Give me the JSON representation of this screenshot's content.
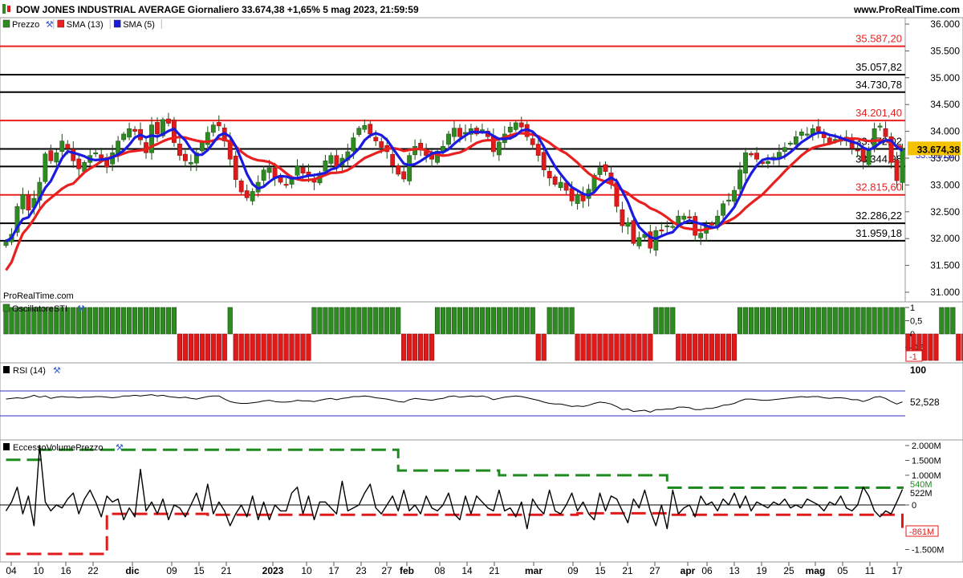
{
  "header": {
    "title": "DOW JONES INDUSTRIAL AVERAGE Giornaliero 33.674,38 +1,65% 5 mag 2023, 21:59:59",
    "brand": "www.ProRealTime.com",
    "watermark": "ProRealTime.com"
  },
  "colors": {
    "up": "#2e8b22",
    "down": "#e01a1a",
    "sma13": "#e82020",
    "sma5": "#1a1ae0",
    "price_tag": "#f5c200"
  },
  "chart_data": [
    {
      "type": "candlestick",
      "legend": [
        {
          "label": "Prezzo",
          "color": "#2e8b22"
        },
        {
          "label": "SMA (13)",
          "color": "#e82020"
        },
        {
          "label": "SMA (5)",
          "color": "#1a1ae0"
        }
      ],
      "ylim": [
        31000,
        36000
      ],
      "y_ticks": [
        "36.000",
        "35.500",
        "35.000",
        "34.500",
        "34.000",
        "33.500",
        "33.000",
        "32.500",
        "32.000",
        "31.500",
        "31.000"
      ],
      "x_ticks": [
        "04",
        "10",
        "16",
        "22",
        "dic",
        "09",
        "15",
        "21",
        "2023",
        "10",
        "17",
        "23",
        "27",
        "feb",
        "08",
        "14",
        "21",
        "mar",
        "09",
        "15",
        "21",
        "27",
        "apr",
        "06",
        "13",
        "19",
        "25",
        "mag",
        "05",
        "11",
        "17"
      ],
      "levels": [
        {
          "value": 35587.2,
          "label": "35.587,20",
          "color": "#e82020"
        },
        {
          "value": 35057.82,
          "label": "35.057,82",
          "color": "#000000"
        },
        {
          "value": 34730.78,
          "label": "34.730,78",
          "color": "#000000"
        },
        {
          "value": 34201.4,
          "label": "34.201,40",
          "color": "#e82020"
        },
        {
          "value": 33672.02,
          "label": "33.672,02",
          "color": "#000000"
        },
        {
          "value": 33344.98,
          "label": "33.344,98",
          "color": "#000000"
        },
        {
          "value": 32815.6,
          "label": "32.815,60",
          "color": "#e82020"
        },
        {
          "value": 32286.22,
          "label": "32.286,22",
          "color": "#000000"
        },
        {
          "value": 31959.18,
          "label": "31.959,18",
          "color": "#000000"
        }
      ],
      "last_price": "33.674,38",
      "sma13_last": "33.608,38",
      "sma5_last": "33.590,32",
      "closes": [
        31950,
        32080,
        32600,
        32820,
        32530,
        32750,
        33050,
        33580,
        33450,
        33600,
        33820,
        33680,
        33450,
        33300,
        33420,
        33550,
        33600,
        33500,
        33330,
        33600,
        33820,
        33950,
        34050,
        34000,
        33840,
        33600,
        34120,
        33950,
        34220,
        34150,
        33790,
        33550,
        33450,
        33420,
        33600,
        33800,
        33980,
        34120,
        34100,
        33820,
        33480,
        33100,
        32870,
        32760,
        32880,
        33050,
        33280,
        33320,
        33130,
        33050,
        33000,
        33120,
        33350,
        33220,
        33180,
        33050,
        33220,
        33450,
        33550,
        33320,
        33500,
        33620,
        33880,
        34060,
        34110,
        33950,
        33820,
        33700,
        33620,
        33360,
        33200,
        33110,
        33550,
        33720,
        33650,
        33550,
        33480,
        33630,
        33720,
        33950,
        34060,
        33900,
        33980,
        34050,
        33950,
        34030,
        33900,
        33620,
        33800,
        33950,
        34080,
        34160,
        34080,
        33900,
        33750,
        33550,
        33280,
        33130,
        33010,
        33050,
        32900,
        32700,
        32820,
        32700,
        32920,
        33180,
        33320,
        33250,
        33020,
        32600,
        32240,
        32300,
        31910,
        32020,
        32080,
        31820,
        32150,
        32160,
        32240,
        32230,
        32420,
        32420,
        32380,
        32060,
        32100,
        32240,
        32250,
        32420,
        32650,
        32720,
        32900,
        33280,
        33600,
        33560,
        33480,
        33400,
        33440,
        33520,
        33610,
        33700,
        33780,
        33900,
        33990,
        33950,
        34050,
        34000,
        33880,
        33780,
        33850,
        33880,
        33820,
        33680,
        33650,
        33440,
        33680,
        34050,
        34100,
        33900,
        33420,
        33080,
        33674
      ]
    },
    {
      "type": "bar",
      "legend": [
        {
          "label": "OscillatoreSTI",
          "color": "#2e8b22"
        }
      ],
      "ylim": [
        -1,
        1
      ],
      "y_ticks": [
        "1",
        "0,5",
        "0",
        "-0,5"
      ],
      "last_value": "-1",
      "values": [
        1,
        1,
        1,
        1,
        1,
        1,
        1,
        1,
        1,
        1,
        1,
        1,
        1,
        1,
        1,
        1,
        1,
        1,
        1,
        1,
        1,
        1,
        1,
        1,
        1,
        1,
        1,
        1,
        1,
        1,
        1,
        -1,
        -1,
        -1,
        -1,
        -1,
        -1,
        -1,
        -1,
        -1,
        1,
        -1,
        -1,
        -1,
        -1,
        -1,
        -1,
        -1,
        -1,
        -1,
        -1,
        -1,
        -1,
        -1,
        -1,
        1,
        1,
        1,
        1,
        1,
        1,
        1,
        1,
        1,
        1,
        1,
        1,
        1,
        1,
        1,
        1,
        -1,
        -1,
        -1,
        -1,
        -1,
        -1,
        1,
        1,
        1,
        1,
        1,
        1,
        1,
        1,
        1,
        1,
        1,
        1,
        1,
        1,
        1,
        1,
        1,
        1,
        -1,
        -1,
        1,
        1,
        1,
        1,
        1,
        -1,
        -1,
        -1,
        -1,
        -1,
        -1,
        -1,
        -1,
        -1,
        -1,
        -1,
        -1,
        -1,
        -1,
        1,
        1,
        1,
        1,
        -1,
        -1,
        -1,
        -1,
        -1,
        -1,
        -1,
        -1,
        -1,
        -1,
        -1,
        1,
        1,
        1,
        1,
        1,
        1,
        1,
        1,
        1,
        1,
        1,
        1,
        1,
        1,
        1,
        1,
        1,
        1,
        1,
        1,
        1,
        1,
        1,
        1,
        1,
        1,
        1,
        1,
        1,
        1,
        -1,
        -1,
        -1,
        -1,
        -1,
        -1,
        1,
        1,
        1,
        -1,
        -1,
        -1,
        -1
      ]
    },
    {
      "type": "line",
      "legend": [
        {
          "label": "RSI (14)",
          "color": "#000000"
        }
      ],
      "ylim": [
        0,
        100
      ],
      "y_ticks": [
        "100"
      ],
      "last_value": "52,528",
      "values": [
        57,
        58,
        59,
        58,
        60,
        63,
        60,
        62,
        58,
        60,
        61,
        60,
        60,
        59,
        60,
        60,
        61,
        61,
        60,
        59,
        60,
        62,
        62,
        63,
        62,
        63,
        64,
        62,
        63,
        61,
        60,
        59,
        60,
        58,
        57,
        59,
        61,
        62,
        62,
        57,
        53,
        51,
        50,
        50,
        51,
        52,
        54,
        55,
        53,
        52,
        52,
        53,
        55,
        54,
        54,
        53,
        55,
        57,
        58,
        56,
        58,
        59,
        61,
        61,
        62,
        61,
        59,
        58,
        57,
        55,
        53,
        52,
        56,
        58,
        57,
        56,
        55,
        57,
        58,
        61,
        62,
        60,
        61,
        62,
        61,
        62,
        60,
        56,
        58,
        60,
        61,
        62,
        61,
        59,
        57,
        55,
        52,
        50,
        49,
        49,
        47,
        45,
        46,
        45,
        47,
        50,
        52,
        51,
        49,
        45,
        40,
        41,
        37,
        38,
        39,
        36,
        40,
        40,
        41,
        41,
        44,
        44,
        43,
        40,
        40,
        42,
        42,
        44,
        47,
        48,
        50,
        54,
        57,
        57,
        56,
        55,
        55,
        56,
        57,
        58,
        59,
        60,
        61,
        60,
        61,
        61,
        59,
        58,
        59,
        59,
        58,
        56,
        56,
        53,
        56,
        60,
        61,
        58,
        53,
        49,
        52.5
      ]
    },
    {
      "type": "line",
      "legend": [
        {
          "label": "EccessoVolumePrezzo",
          "color": "#000000"
        }
      ],
      "ylim": [
        -1900000,
        2200000
      ],
      "y_ticks": [
        "2.000M",
        "1.500M",
        "1.000M",
        "0",
        "-1.500M"
      ],
      "upper_band_last": "540M",
      "value_last": "522M",
      "zero_label": "0",
      "lower_band_last": "-861M",
      "values": [
        -200000,
        100000,
        600000,
        -300000,
        300000,
        -700000,
        2000000,
        100000,
        -200000,
        0,
        -100000,
        200000,
        400000,
        -300000,
        200000,
        500000,
        100000,
        -400000,
        300000,
        100000,
        200000,
        -500000,
        -100000,
        -400000,
        1200000,
        -200000,
        100000,
        -300000,
        200000,
        -500000,
        0,
        -100000,
        -400000,
        0,
        400000,
        -200000,
        700000,
        -300000,
        100000,
        -200000,
        -700000,
        -300000,
        0,
        -400000,
        300000,
        -500000,
        100000,
        -500000,
        0,
        -200000,
        -200000,
        400000,
        600000,
        -300000,
        300000,
        -500000,
        100000,
        100000,
        -100000,
        -300000,
        800000,
        -200000,
        -100000,
        0,
        400000,
        700000,
        -100000,
        -300000,
        0,
        300000,
        -200000,
        500000,
        -200000,
        0,
        -300000,
        300000,
        -100000,
        -200000,
        0,
        400000,
        -300000,
        -500000,
        300000,
        -300000,
        300000,
        100000,
        -100000,
        -200000,
        500000,
        -200000,
        -100000,
        -400000,
        100000,
        -800000,
        200000,
        -100000,
        -300000,
        500000,
        -200000,
        -300000,
        0,
        400000,
        -200000,
        100000,
        -300000,
        -500000,
        400000,
        -200000,
        300000,
        200000,
        -200000,
        -600000,
        200000,
        -100000,
        500000,
        -200000,
        -700000,
        0,
        -800000,
        500000,
        -300000,
        -100000,
        0,
        -400000,
        300000,
        0,
        100000,
        -200000,
        200000,
        0,
        400000,
        -100000,
        300000,
        -200000,
        100000,
        0,
        -100000,
        100000,
        0,
        200000,
        -100000,
        0,
        -100000,
        200000,
        100000,
        0,
        -200000,
        100000,
        0,
        300000,
        -100000,
        -200000,
        0,
        600000,
        300000,
        -200000,
        -400000,
        -200000,
        -300000,
        100000,
        522000
      ],
      "upper_band": [
        1520000,
        1520000,
        1520000,
        1520000,
        1520000,
        1520000,
        1860000,
        1860000,
        1860000,
        1860000,
        1860000,
        1860000,
        1860000,
        1860000,
        1860000,
        1860000,
        1860000,
        1860000,
        1860000,
        1860000,
        1860000,
        1860000,
        1860000,
        1860000,
        1860000,
        1860000,
        1860000,
        1860000,
        1860000,
        1860000,
        1860000,
        1860000,
        1860000,
        1860000,
        1860000,
        1860000,
        1860000,
        1860000,
        1860000,
        1860000,
        1860000,
        1860000,
        1860000,
        1860000,
        1860000,
        1860000,
        1860000,
        1860000,
        1860000,
        1860000,
        1860000,
        1860000,
        1860000,
        1860000,
        1860000,
        1860000,
        1860000,
        1860000,
        1860000,
        1860000,
        1860000,
        1860000,
        1860000,
        1860000,
        1860000,
        1860000,
        1860000,
        1860000,
        1860000,
        1860000,
        1860000,
        1860000,
        1860000,
        1860000,
        1860000,
        1860000,
        1860000,
        1860000,
        1860000,
        1860000,
        1860000,
        1860000,
        1860000,
        1860000,
        1860000,
        1860000,
        1860000,
        1860000,
        1860000,
        1860000,
        1860000,
        1860000,
        1860000,
        1860000,
        1860000,
        1860000,
        1860000,
        1860000,
        1860000,
        1860000,
        1860000,
        1860000,
        1860000,
        1860000,
        1860000,
        1860000,
        1860000,
        1860000,
        1860000,
        1860000,
        1860000,
        1860000,
        1860000,
        1860000,
        1860000,
        1860000,
        1860000,
        1860000,
        1860000,
        1860000,
        1860000,
        1860000,
        1860000,
        1860000,
        1860000,
        1860000,
        1860000,
        1860000,
        1860000,
        1860000,
        1860000,
        1860000,
        1860000,
        1860000,
        1860000,
        1860000,
        1860000,
        1860000,
        1860000,
        1860000,
        1860000,
        1860000,
        1860000,
        1860000,
        1860000,
        1860000,
        1860000,
        1860000,
        1860000,
        1860000,
        1860000,
        1860000,
        1860000,
        1860000,
        1860000,
        1860000,
        1860000,
        1860000,
        1860000,
        1860000,
        1860000,
        1860000,
        1860000,
        1860000,
        1860000
      ],
      "upper_band_steps": [
        [
          0,
          1520000
        ],
        [
          6,
          1860000
        ],
        [
          70,
          1160000
        ],
        [
          88,
          1000000
        ],
        [
          118,
          580000
        ],
        [
          160,
          540000
        ]
      ],
      "lower_band_steps": [
        [
          0,
          -1650000
        ],
        [
          18,
          -300000
        ],
        [
          36,
          -330000
        ],
        [
          102,
          -280000
        ],
        [
          119,
          -330000
        ],
        [
          160,
          -861000
        ]
      ]
    }
  ]
}
